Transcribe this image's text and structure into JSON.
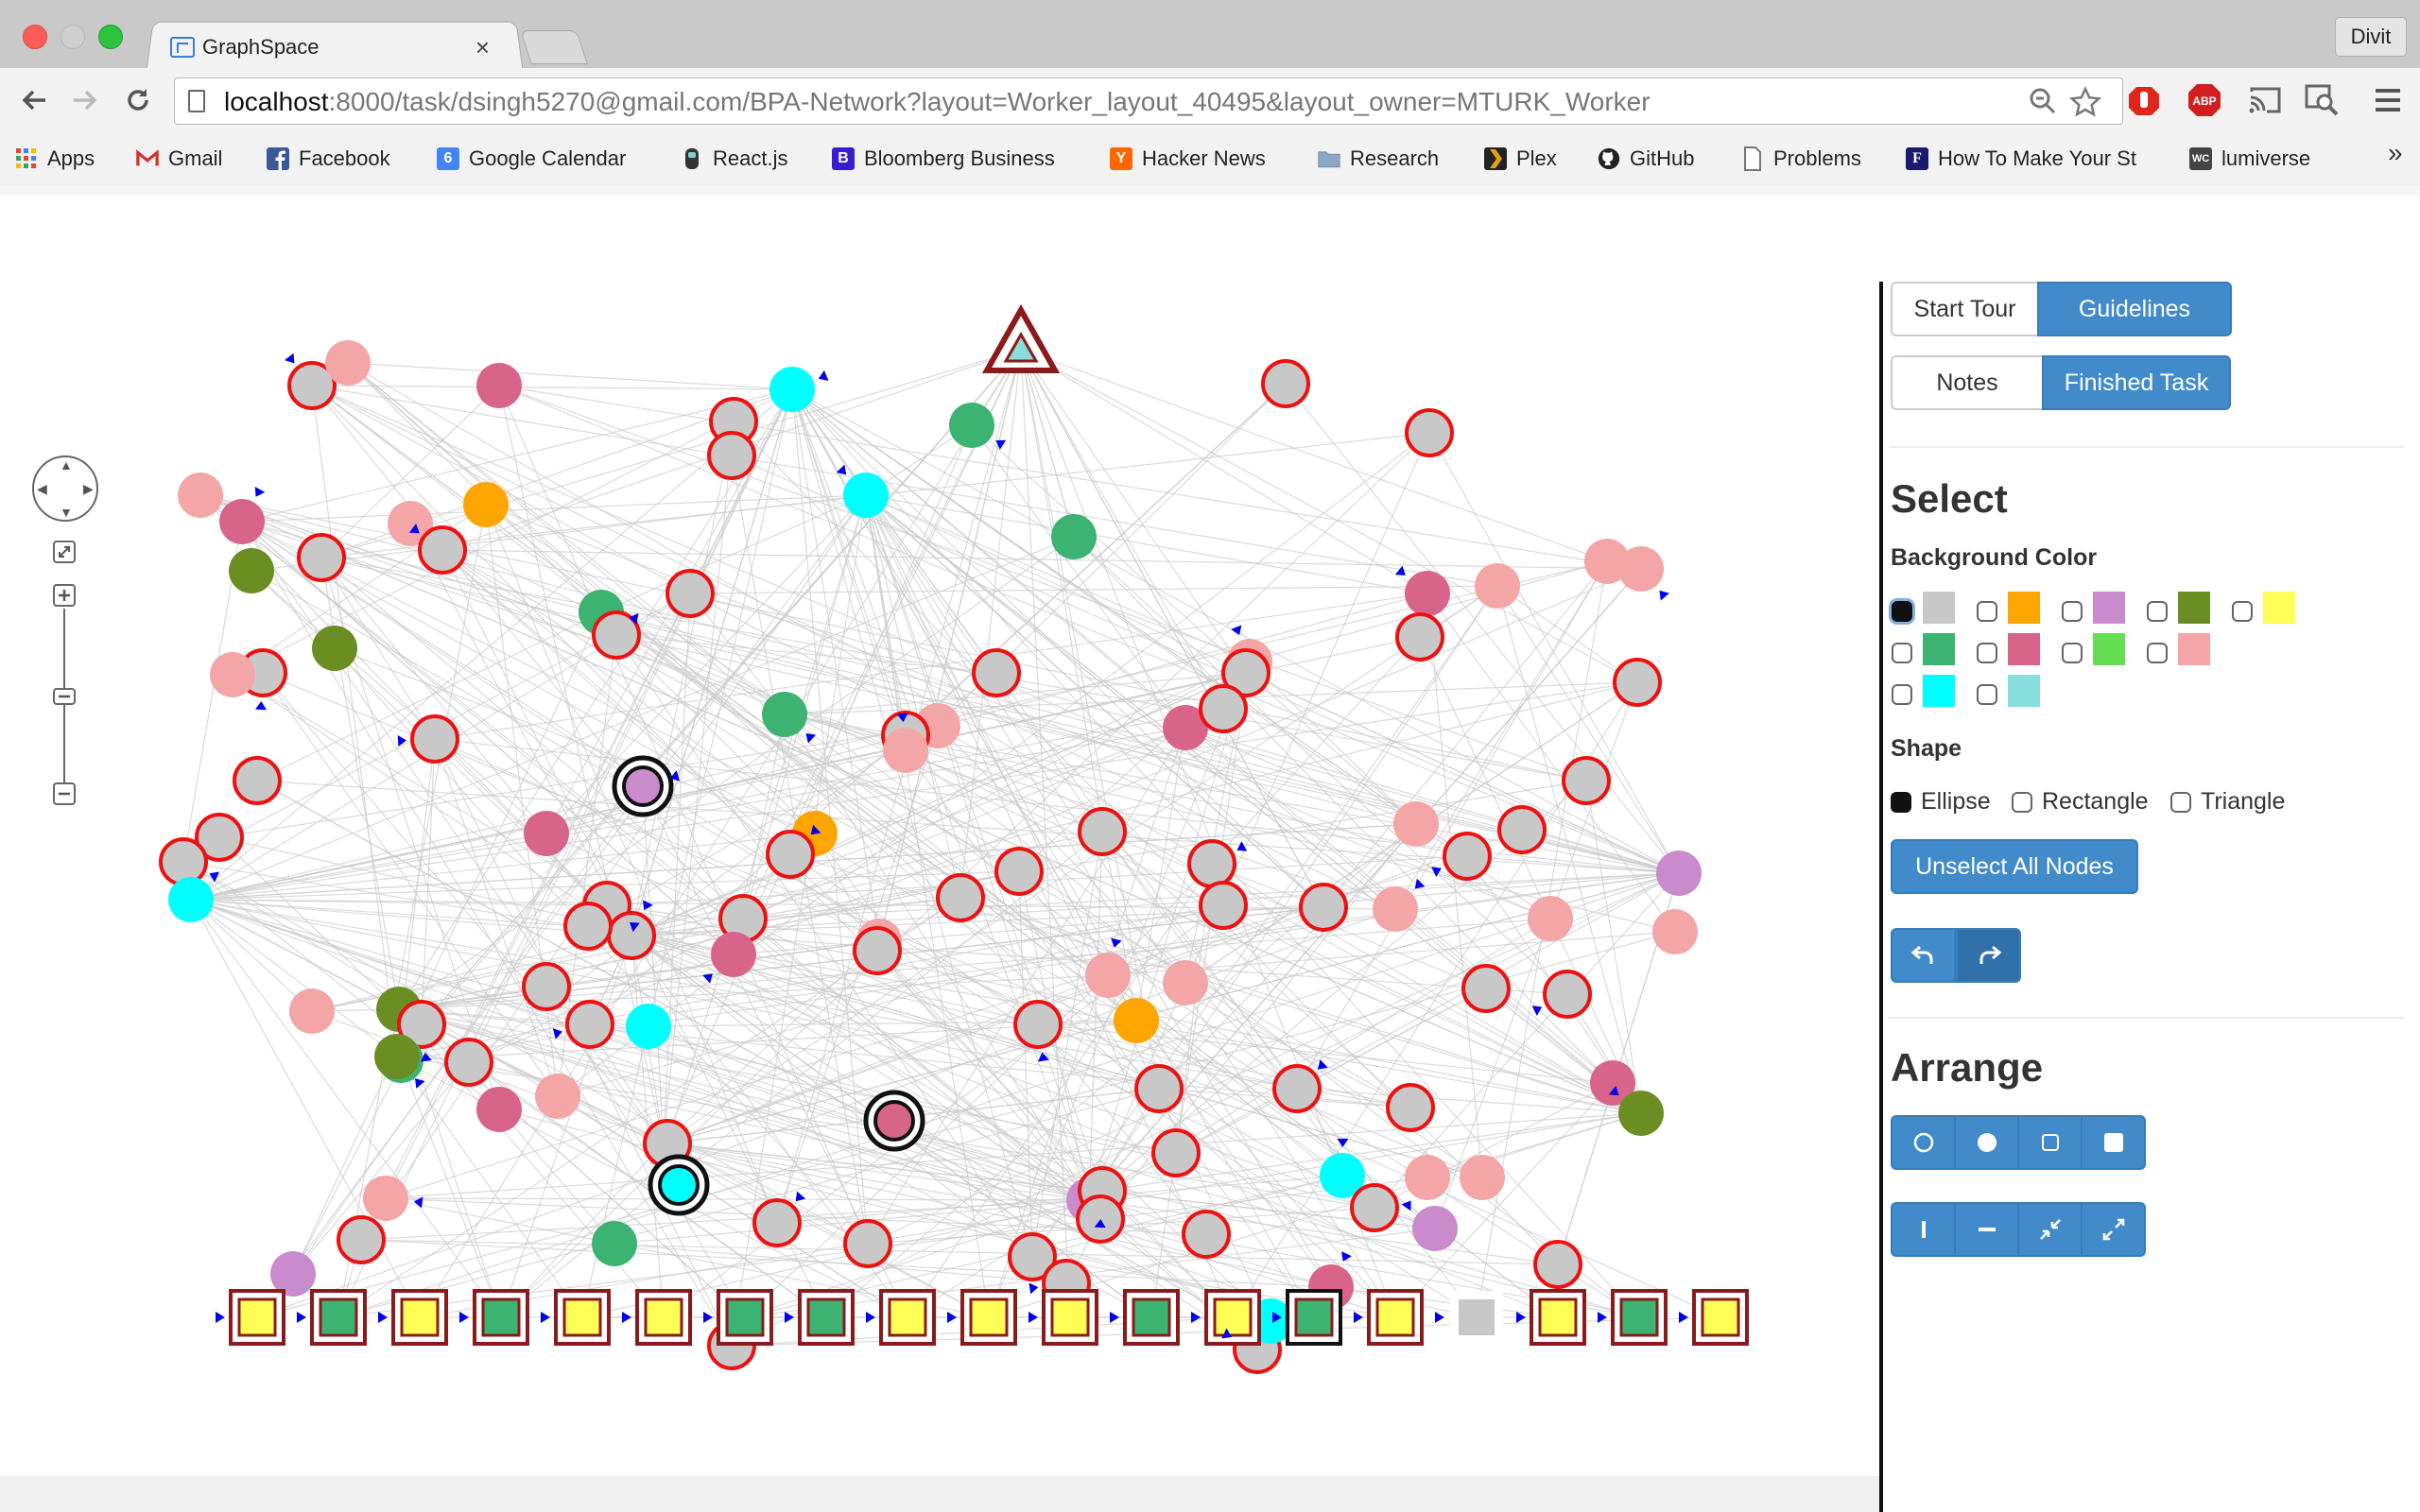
{
  "browser": {
    "tab_title": "GraphSpace",
    "tab_close": "×",
    "profile_name": "Divit",
    "url_host": "localhost",
    "url_rest": ":8000/task/dsingh5270@gmail.com/BPA-Network?layout=Worker_layout_40495&layout_owner=MTURK_Worker",
    "ext_abp_label": "ABP",
    "bookmarks": [
      {
        "label": "Apps",
        "icon": "apps-grid-icon",
        "color": "#e94435"
      },
      {
        "label": "Gmail",
        "icon": "gmail-icon",
        "color": "#d93025"
      },
      {
        "label": "Facebook",
        "icon": "facebook-icon",
        "color": "#3b5998"
      },
      {
        "label": "Google Calendar",
        "icon": "calendar-icon",
        "color": "#4285f4"
      },
      {
        "label": "React.js",
        "icon": "react-icon",
        "color": "#333333"
      },
      {
        "label": "Bloomberg Business",
        "icon": "bloomberg-icon",
        "color": "#3a1cd0"
      },
      {
        "label": "Hacker News",
        "icon": "hackernews-icon",
        "color": "#ff6600"
      },
      {
        "label": "Research",
        "icon": "folder-icon",
        "color": "#8aa6c8"
      },
      {
        "label": "Plex",
        "icon": "plex-icon",
        "color": "#222222"
      },
      {
        "label": "GitHub",
        "icon": "github-icon",
        "color": "#222222"
      },
      {
        "label": "Problems",
        "icon": "document-icon",
        "color": "#888888"
      },
      {
        "label": "How To Make Your St",
        "icon": "forbes-icon",
        "color": "#1a1a6e"
      },
      {
        "label": "lumiverse",
        "icon": "lumiverse-icon",
        "color": "#444444"
      }
    ],
    "bookmark_glyphs": {
      "calendar": "6",
      "bloomberg": "B",
      "hackernews": "Y",
      "forbes": "F",
      "lumiverse": "WC"
    },
    "bookmarks_overflow": "»"
  },
  "panel": {
    "start_tour": "Start Tour",
    "guidelines": "Guidelines",
    "notes": "Notes",
    "finished_task": "Finished Task",
    "select_heading": "Select",
    "background_color_heading": "Background Color",
    "swatches": [
      "#c8c8c8",
      "#ffa500",
      "#c98bcb",
      "#6b8e23",
      "#ffff55",
      "#3cb371",
      "#d9648a",
      "#66dd55",
      "#f4a6a6",
      "#00ffff",
      "#88dddd"
    ],
    "shape_heading": "Shape",
    "shape_ellipse": "Ellipse",
    "shape_rectangle": "Rectangle",
    "shape_triangle": "Triangle",
    "unselect_all": "Unselect All Nodes",
    "arrange_heading": "Arrange"
  },
  "graph": {
    "accent_color": "#428bca",
    "edge_color": "#cccccc",
    "node_border_red": "#ee1111",
    "node_fill_gray": "#c8c8c8"
  }
}
